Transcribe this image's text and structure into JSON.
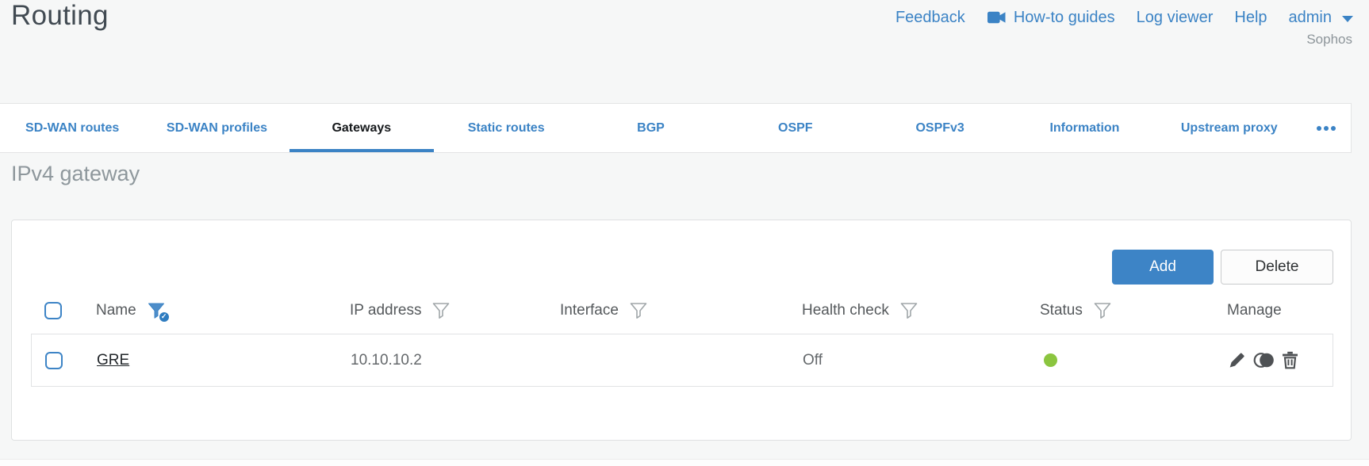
{
  "header": {
    "title": "Routing",
    "brand": "Sophos",
    "links": {
      "feedback": "Feedback",
      "howto": "How-to guides",
      "logviewer": "Log viewer",
      "help": "Help",
      "user": "admin"
    }
  },
  "tabs": [
    {
      "label": "SD-WAN routes",
      "active": false
    },
    {
      "label": "SD-WAN profiles",
      "active": false
    },
    {
      "label": "Gateways",
      "active": true
    },
    {
      "label": "Static routes",
      "active": false
    },
    {
      "label": "BGP",
      "active": false
    },
    {
      "label": "OSPF",
      "active": false
    },
    {
      "label": "OSPFv3",
      "active": false
    },
    {
      "label": "Information",
      "active": false
    },
    {
      "label": "Upstream proxy",
      "active": false
    }
  ],
  "section_title": "IPv4 gateway",
  "toolbar": {
    "add": "Add",
    "delete": "Delete"
  },
  "table": {
    "columns": [
      {
        "label": "Name",
        "filter": "applied"
      },
      {
        "label": "IP address",
        "filter": "default"
      },
      {
        "label": "Interface",
        "filter": "default"
      },
      {
        "label": "Health check",
        "filter": "default"
      },
      {
        "label": "Status",
        "filter": "default"
      },
      {
        "label": "Manage",
        "filter": "none"
      }
    ],
    "rows": [
      {
        "name": "GRE",
        "ip_address": "10.10.10.2",
        "interface": "",
        "health_check": "Off",
        "status": "up"
      }
    ]
  },
  "icons": {
    "howto": "video-camera-icon",
    "user_menu": "caret-down-icon",
    "more_tabs": "ellipsis-icon",
    "filter": "funnel-icon",
    "filter_applied": "funnel-check-icon",
    "edit": "pencil-icon",
    "clone": "clone-icon",
    "delete": "trash-icon",
    "status_up": "green-dot"
  },
  "colors": {
    "accent_blue": "#3b83c5",
    "button_blue": "#3d84c6",
    "status_green": "#8bc53f",
    "page_bg": "#f6f7f7",
    "heading_gray": "#8e979c"
  }
}
